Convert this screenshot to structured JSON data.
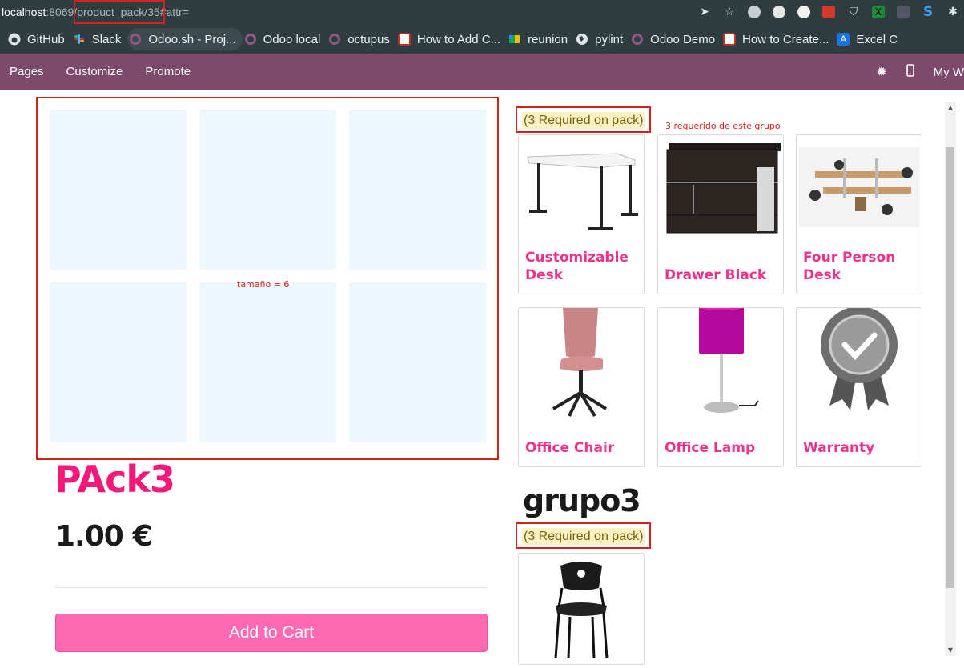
{
  "browser": {
    "url_host": "localhost",
    "url_rest": ":8069/product_pack/35#attr=",
    "icons": [
      "send-icon",
      "star-icon",
      "extension-icon",
      "extension-icon",
      "extension-icon",
      "extension-icon",
      "shield-icon",
      "extension-icon",
      "zip-icon",
      "s-icon",
      "puzzle-icon"
    ]
  },
  "bookmarks": [
    {
      "label": "GitHub",
      "icon": "github-icon"
    },
    {
      "label": "Slack",
      "icon": "slack-icon"
    },
    {
      "label": "Odoo.sh - Proj...",
      "icon": "odoo-icon",
      "active": true
    },
    {
      "label": "Odoo local",
      "icon": "odoo-icon"
    },
    {
      "label": "octupus",
      "icon": "odoo-icon"
    },
    {
      "label": "How to Add C...",
      "icon": "bookmark-icon"
    },
    {
      "label": "reunion",
      "icon": "meet-icon"
    },
    {
      "label": "pylint",
      "icon": "globe-icon"
    },
    {
      "label": "Odoo Demo",
      "icon": "odoo-icon"
    },
    {
      "label": "How to Create...",
      "icon": "bookmark-icon"
    },
    {
      "label": "Excel C",
      "icon": "translate-icon"
    }
  ],
  "odoo_bar": {
    "menu": [
      "Pages",
      "Customize",
      "Promote"
    ],
    "right_label": "My W"
  },
  "product": {
    "grid_note": "tamaño = 6",
    "title": "PAck3",
    "price": "1.00 €",
    "add_to_cart": "Add to Cart"
  },
  "group1": {
    "required_label": "(3 Required on pack)",
    "note": "3 requerido de este grupo",
    "items": [
      {
        "name": "Customizable Desk",
        "icon": "desk-icon"
      },
      {
        "name": "Drawer Black",
        "icon": "drawer-icon"
      },
      {
        "name": "Four Person Desk",
        "icon": "office-desk-icon"
      },
      {
        "name": "Office Chair",
        "icon": "chair-icon"
      },
      {
        "name": "Office Lamp",
        "icon": "lamp-icon"
      },
      {
        "name": "Warranty",
        "icon": "warranty-badge-icon"
      }
    ]
  },
  "group2": {
    "title": "grupo3",
    "required_label": "(3 Required on pack)",
    "items": [
      {
        "name": "",
        "icon": "stacking-chair-icon"
      }
    ]
  }
}
